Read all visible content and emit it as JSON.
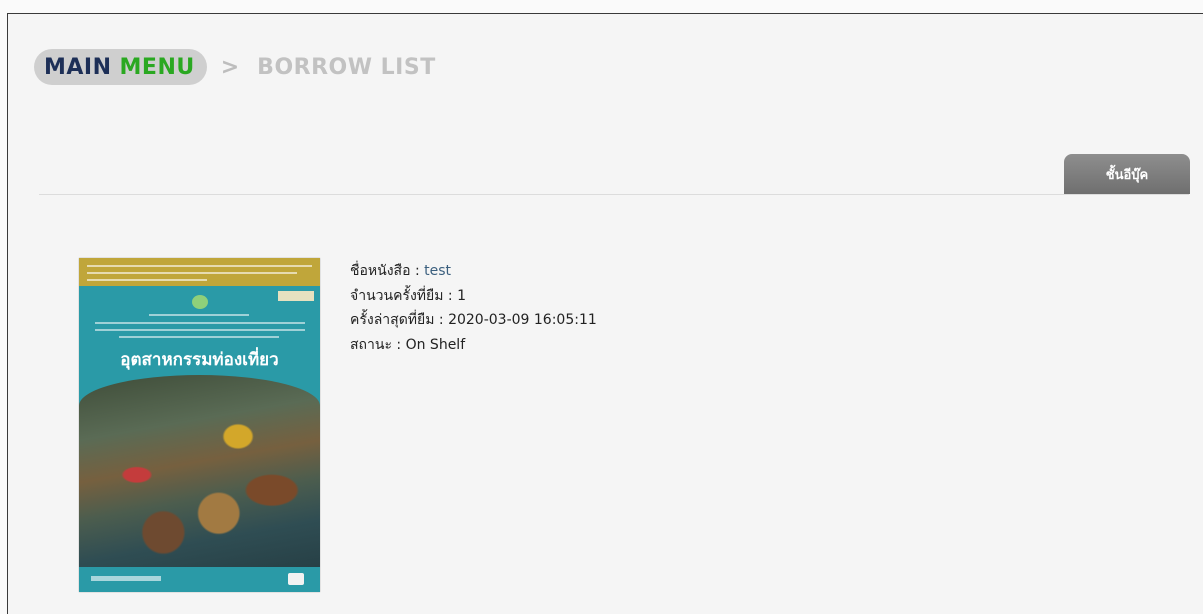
{
  "breadcrumb": {
    "main_word1": "MAIN",
    "main_word2": "MENU",
    "separator": ">",
    "current": "BORROW LIST"
  },
  "tab": {
    "shelf_label": "ชั้นอีบุ๊ค"
  },
  "book": {
    "cover_title": "อุตสาหกรรมท่องเที่ยว",
    "name_label": "ชื่อหนังสือ :",
    "name_value": "test",
    "borrow_count_label": "จำนวนครั้งที่ยืม :",
    "borrow_count_value": "1",
    "last_borrow_label": "ครั้งล่าสุดที่ยืม :",
    "last_borrow_value": "2020-03-09 16:05:11",
    "status_label": "สถานะ :",
    "status_value": "On Shelf"
  },
  "colors": {
    "main_text": "#1d2f57",
    "menu_green": "#2aa821",
    "tab_gray": "#7a7a7a",
    "cover_teal": "#2a9aa7"
  }
}
